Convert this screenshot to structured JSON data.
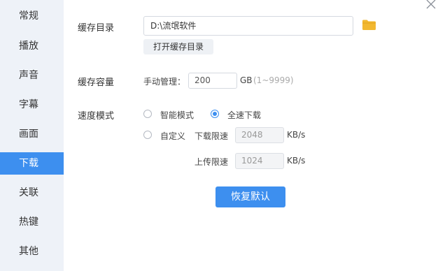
{
  "sidebar": {
    "items": [
      {
        "label": "常规"
      },
      {
        "label": "播放"
      },
      {
        "label": "声音"
      },
      {
        "label": "字幕"
      },
      {
        "label": "画面"
      },
      {
        "label": "下载",
        "active": true
      },
      {
        "label": "关联"
      },
      {
        "label": "热键"
      },
      {
        "label": "其他"
      }
    ]
  },
  "cache_dir": {
    "label": "缓存目录",
    "path": "D:\\流氓软件",
    "open_button": "打开缓存目录",
    "folder_icon": "folder-icon"
  },
  "cache_size": {
    "label": "缓存容量",
    "manual_label": "手动管理：",
    "value": "200",
    "unit": "GB",
    "range": "(1~9999)"
  },
  "speed_mode": {
    "label": "速度模式",
    "options": [
      {
        "label": "智能模式",
        "checked": false
      },
      {
        "label": "全速下载",
        "checked": true
      },
      {
        "label": "自定义",
        "checked": false
      }
    ],
    "download_limit_label": "下载限速",
    "download_limit_value": "2048",
    "upload_limit_label": "上传限速",
    "upload_limit_value": "1024",
    "rate_unit": "KB/s"
  },
  "restore_button": "恢复默认",
  "colors": {
    "accent": "#3d8fef",
    "sidebar_bg": "#eef2f8",
    "folder": "#f2b830"
  }
}
